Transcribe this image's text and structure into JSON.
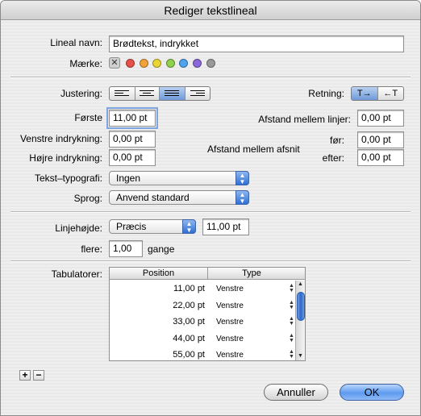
{
  "window": {
    "title": "Rediger tekstlineal"
  },
  "ruler": {
    "name_label": "Lineal navn:",
    "name_value": "Brødtekst, indrykket",
    "mark_label": "Mærke:",
    "mark_none_glyph": "✕",
    "mark_colors": [
      "#e8504a",
      "#f3a23a",
      "#e9d635",
      "#8fd14a",
      "#4ea3ef",
      "#8b67d9",
      "#9a9a9a"
    ]
  },
  "justify": {
    "label": "Justering:",
    "selected_index": 2
  },
  "direction": {
    "label": "Retning:",
    "ltr_glyph": "T→",
    "rtl_glyph": "←T"
  },
  "indent": {
    "first_label": "Første",
    "first_value": "11,00 pt",
    "left_label": "Venstre indrykning:",
    "left_value": "0,00 pt",
    "right_label": "Højre indrykning:",
    "right_value": "0,00 pt"
  },
  "spacing": {
    "lines_label": "Afstand mellem linjer:",
    "lines_value": "0,00 pt",
    "para_label": "Afstand mellem afsnit",
    "before_label": "før:",
    "before_value": "0,00 pt",
    "after_label": "efter:",
    "after_value": "0,00 pt"
  },
  "typography": {
    "label": "Tekst–typografi:",
    "value": "Ingen"
  },
  "language": {
    "label": "Sprog:",
    "value": "Anvend standard"
  },
  "line_height": {
    "label": "Linjehøjde:",
    "mode": "Præcis",
    "value": "11,00 pt",
    "multiple_label": "flere:",
    "multiple_value": "1,00",
    "multiple_unit": "gange"
  },
  "tabs": {
    "label": "Tabulatorer:",
    "col_position": "Position",
    "col_type": "Type",
    "rows": [
      {
        "position": "11,00 pt",
        "type": "Venstre"
      },
      {
        "position": "22,00 pt",
        "type": "Venstre"
      },
      {
        "position": "33,00 pt",
        "type": "Venstre"
      },
      {
        "position": "44,00 pt",
        "type": "Venstre"
      },
      {
        "position": "55,00 pt",
        "type": "Venstre"
      }
    ],
    "add_glyph": "+",
    "remove_glyph": "−"
  },
  "buttons": {
    "cancel": "Annuller",
    "ok": "OK"
  }
}
